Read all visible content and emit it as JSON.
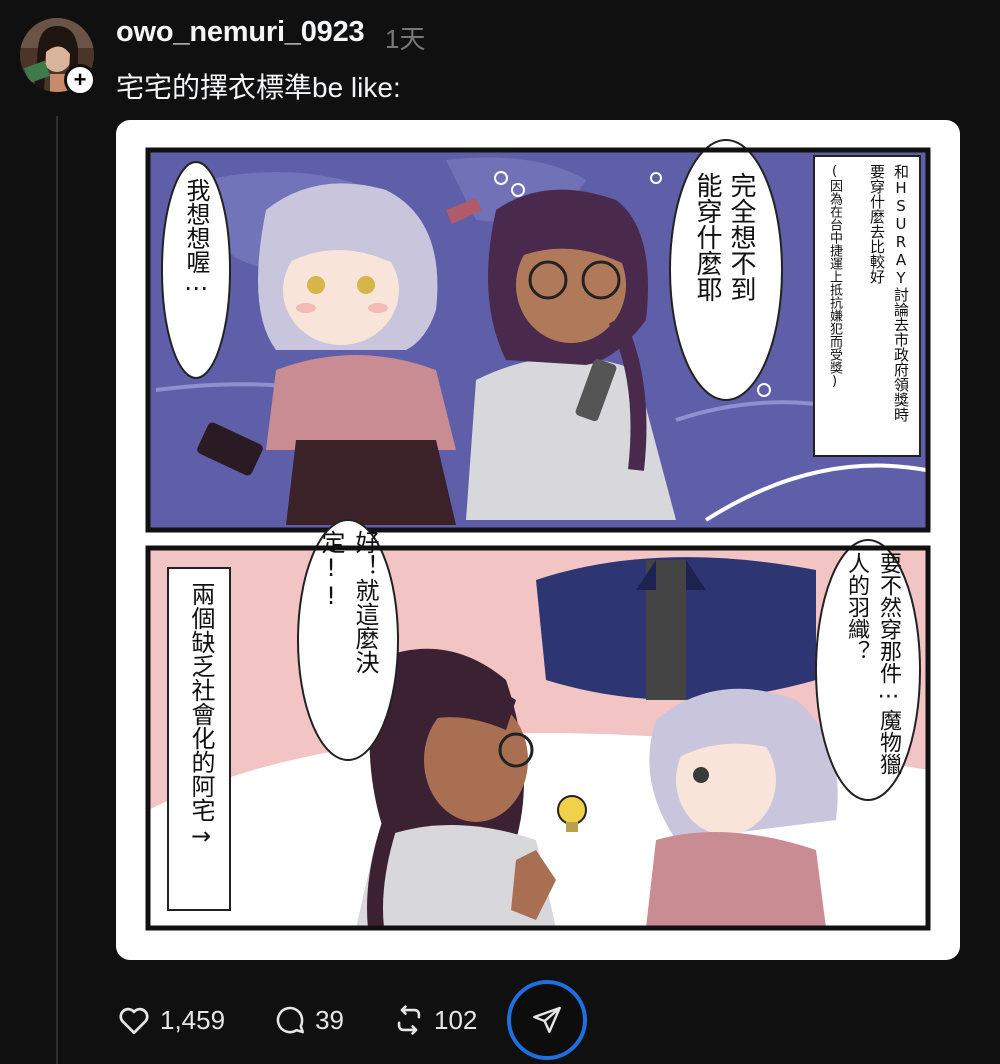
{
  "post": {
    "username": "owo_nemuri_0923",
    "timestamp": "1天",
    "caption": "宅宅的擇衣標準be like:",
    "follow_badge": "+"
  },
  "comic": {
    "panel1": {
      "bubble_left": "我想想喔⋯",
      "bubble_right": "完全想不到能穿什麼耶",
      "narration_col1": "和HSURAY討論去市政府領獎時",
      "narration_col2": "要穿什麼去比較好",
      "narration_col3": "(因為在台中捷運上抵抗嫌犯而受獎)"
    },
    "panel2": {
      "narration": "兩個缺乏社會化的阿宅→",
      "bubble_left": "好！就這麼決定!!",
      "bubble_right": "要不然穿那件⋯魔物獵人的羽織？"
    }
  },
  "actions": {
    "likes": "1,459",
    "replies": "39",
    "reposts": "102"
  },
  "icons": {
    "like": "heart-icon",
    "reply": "speech-bubble-icon",
    "repost": "repost-icon",
    "share": "send-icon",
    "follow": "plus-icon"
  },
  "colors": {
    "background": "#101010",
    "text": "#f3f5f7",
    "muted": "#777777",
    "share_ring": "#1f6fe0"
  }
}
